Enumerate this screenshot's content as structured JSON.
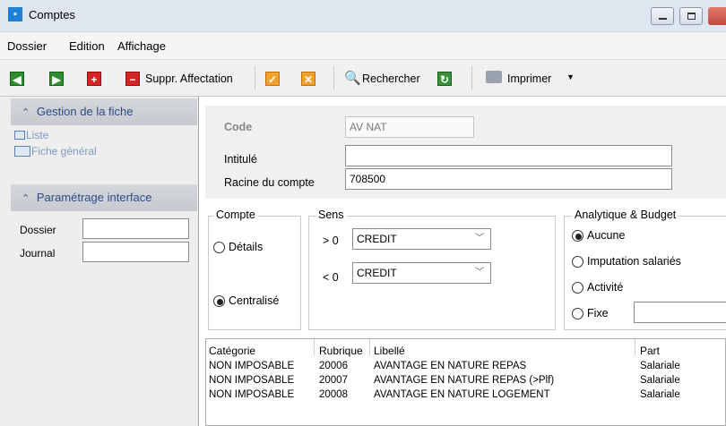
{
  "window": {
    "title": "Comptes"
  },
  "menu": {
    "items": [
      "Dossier",
      "Edition",
      "Affichage"
    ]
  },
  "toolbar": {
    "delete_assignment_label": "Suppr. Affectation",
    "search_label": "Rechercher",
    "print_label": "Imprimer"
  },
  "sidebar": {
    "section1_title": "Gestion de la fiche",
    "link_list": "Liste",
    "link_general": "Fiche général",
    "section2_title": "Paramétrage interface",
    "dossier_label": "Dossier",
    "dossier_value": "",
    "journal_label": "Journal",
    "journal_value": ""
  },
  "form": {
    "code_label": "Code",
    "code_value": "AV NAT",
    "intitule_label": "Intitulé",
    "intitule_value": "",
    "racine_label": "Racine du compte",
    "racine_value": "708500"
  },
  "compte": {
    "title": "Compte",
    "option_details": "Détails",
    "option_centralise": "Centralisé",
    "selected": "Centralisé"
  },
  "sens": {
    "title": "Sens",
    "gt_label": "> 0",
    "gt_value": "CREDIT",
    "lt_label": "< 0",
    "lt_value": "CREDIT"
  },
  "analytique": {
    "title": "Analytique & Budget",
    "option_aucune": "Aucune",
    "option_imputation": "Imputation salariés",
    "option_activite": "Activité",
    "option_fixe": "Fixe",
    "fixe_value": "",
    "selected": "Aucune"
  },
  "table": {
    "columns": [
      "Catégorie",
      "Rubrique",
      "Libellé",
      "Part"
    ],
    "rows": [
      [
        "NON IMPOSABLE",
        "20006",
        "AVANTAGE EN NATURE REPAS",
        "Salariale"
      ],
      [
        "NON IMPOSABLE",
        "20007",
        "AVANTAGE EN NATURE REPAS (>Plf)",
        "Salariale"
      ],
      [
        "NON IMPOSABLE",
        "20008",
        "AVANTAGE EN NATURE LOGEMENT",
        "Salariale"
      ]
    ]
  },
  "colors": {
    "accent": "#1e7fd6",
    "section_header_text": "#2b4c86",
    "link": "#7d9bc4"
  }
}
